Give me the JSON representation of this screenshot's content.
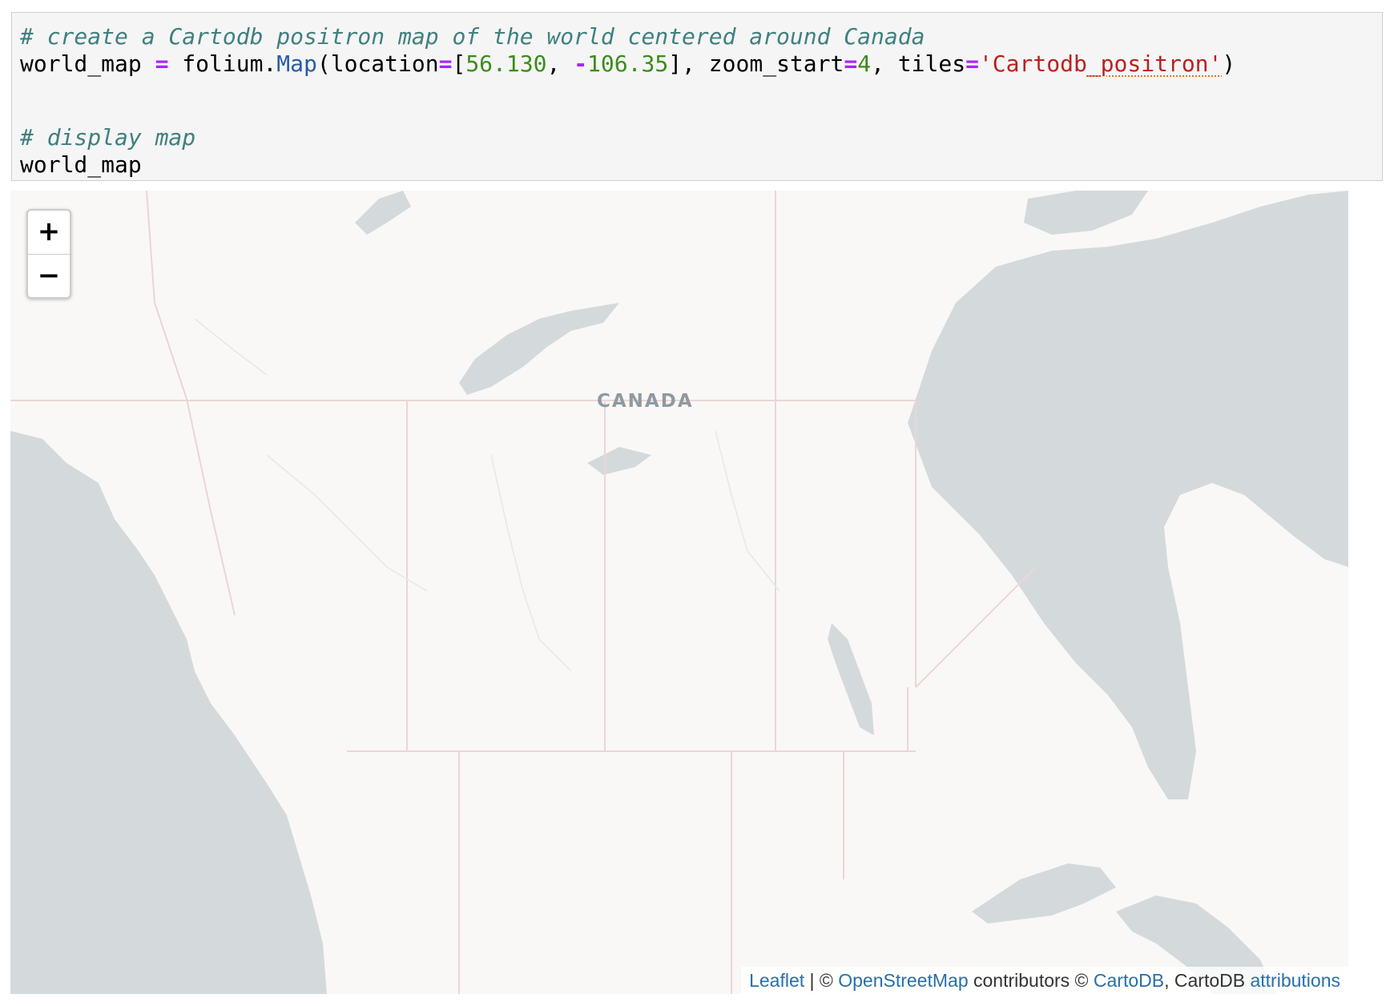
{
  "code_cell": {
    "comment_1": "# create a Cartodb positron map of the world centered around Canada",
    "line_2": {
      "var": "world_map ",
      "assign": "=",
      "obj": " folium.",
      "fn": "Map",
      "open": "(location",
      "eq1": "=",
      "bracket_open": "[",
      "lat": "56.130",
      "comma": ", ",
      "minus": "-",
      "lon": "106.35",
      "close1": "], zoom_start",
      "eq2": "=",
      "zoom": "4",
      "tiles_kw": ", tiles",
      "eq3": "=",
      "str_a": "'Cartodb",
      "str_b": "_positron'",
      "close2": ")"
    },
    "comment_2": "# display map",
    "line_5": "world_map"
  },
  "map": {
    "zoom_in_label": "+",
    "zoom_out_label": "−",
    "country_label": "CANADA",
    "attribution": {
      "leaflet": "Leaflet",
      "sep": " | © ",
      "osm": "OpenStreetMap",
      "contributors": " contributors © ",
      "cartodb": "CartoDB",
      "cartodb_plain": ", CartoDB ",
      "attributions": "attributions"
    },
    "colors": {
      "land": "#f9f8f6",
      "water": "#d4dadc",
      "border": "#ead6d6"
    }
  }
}
